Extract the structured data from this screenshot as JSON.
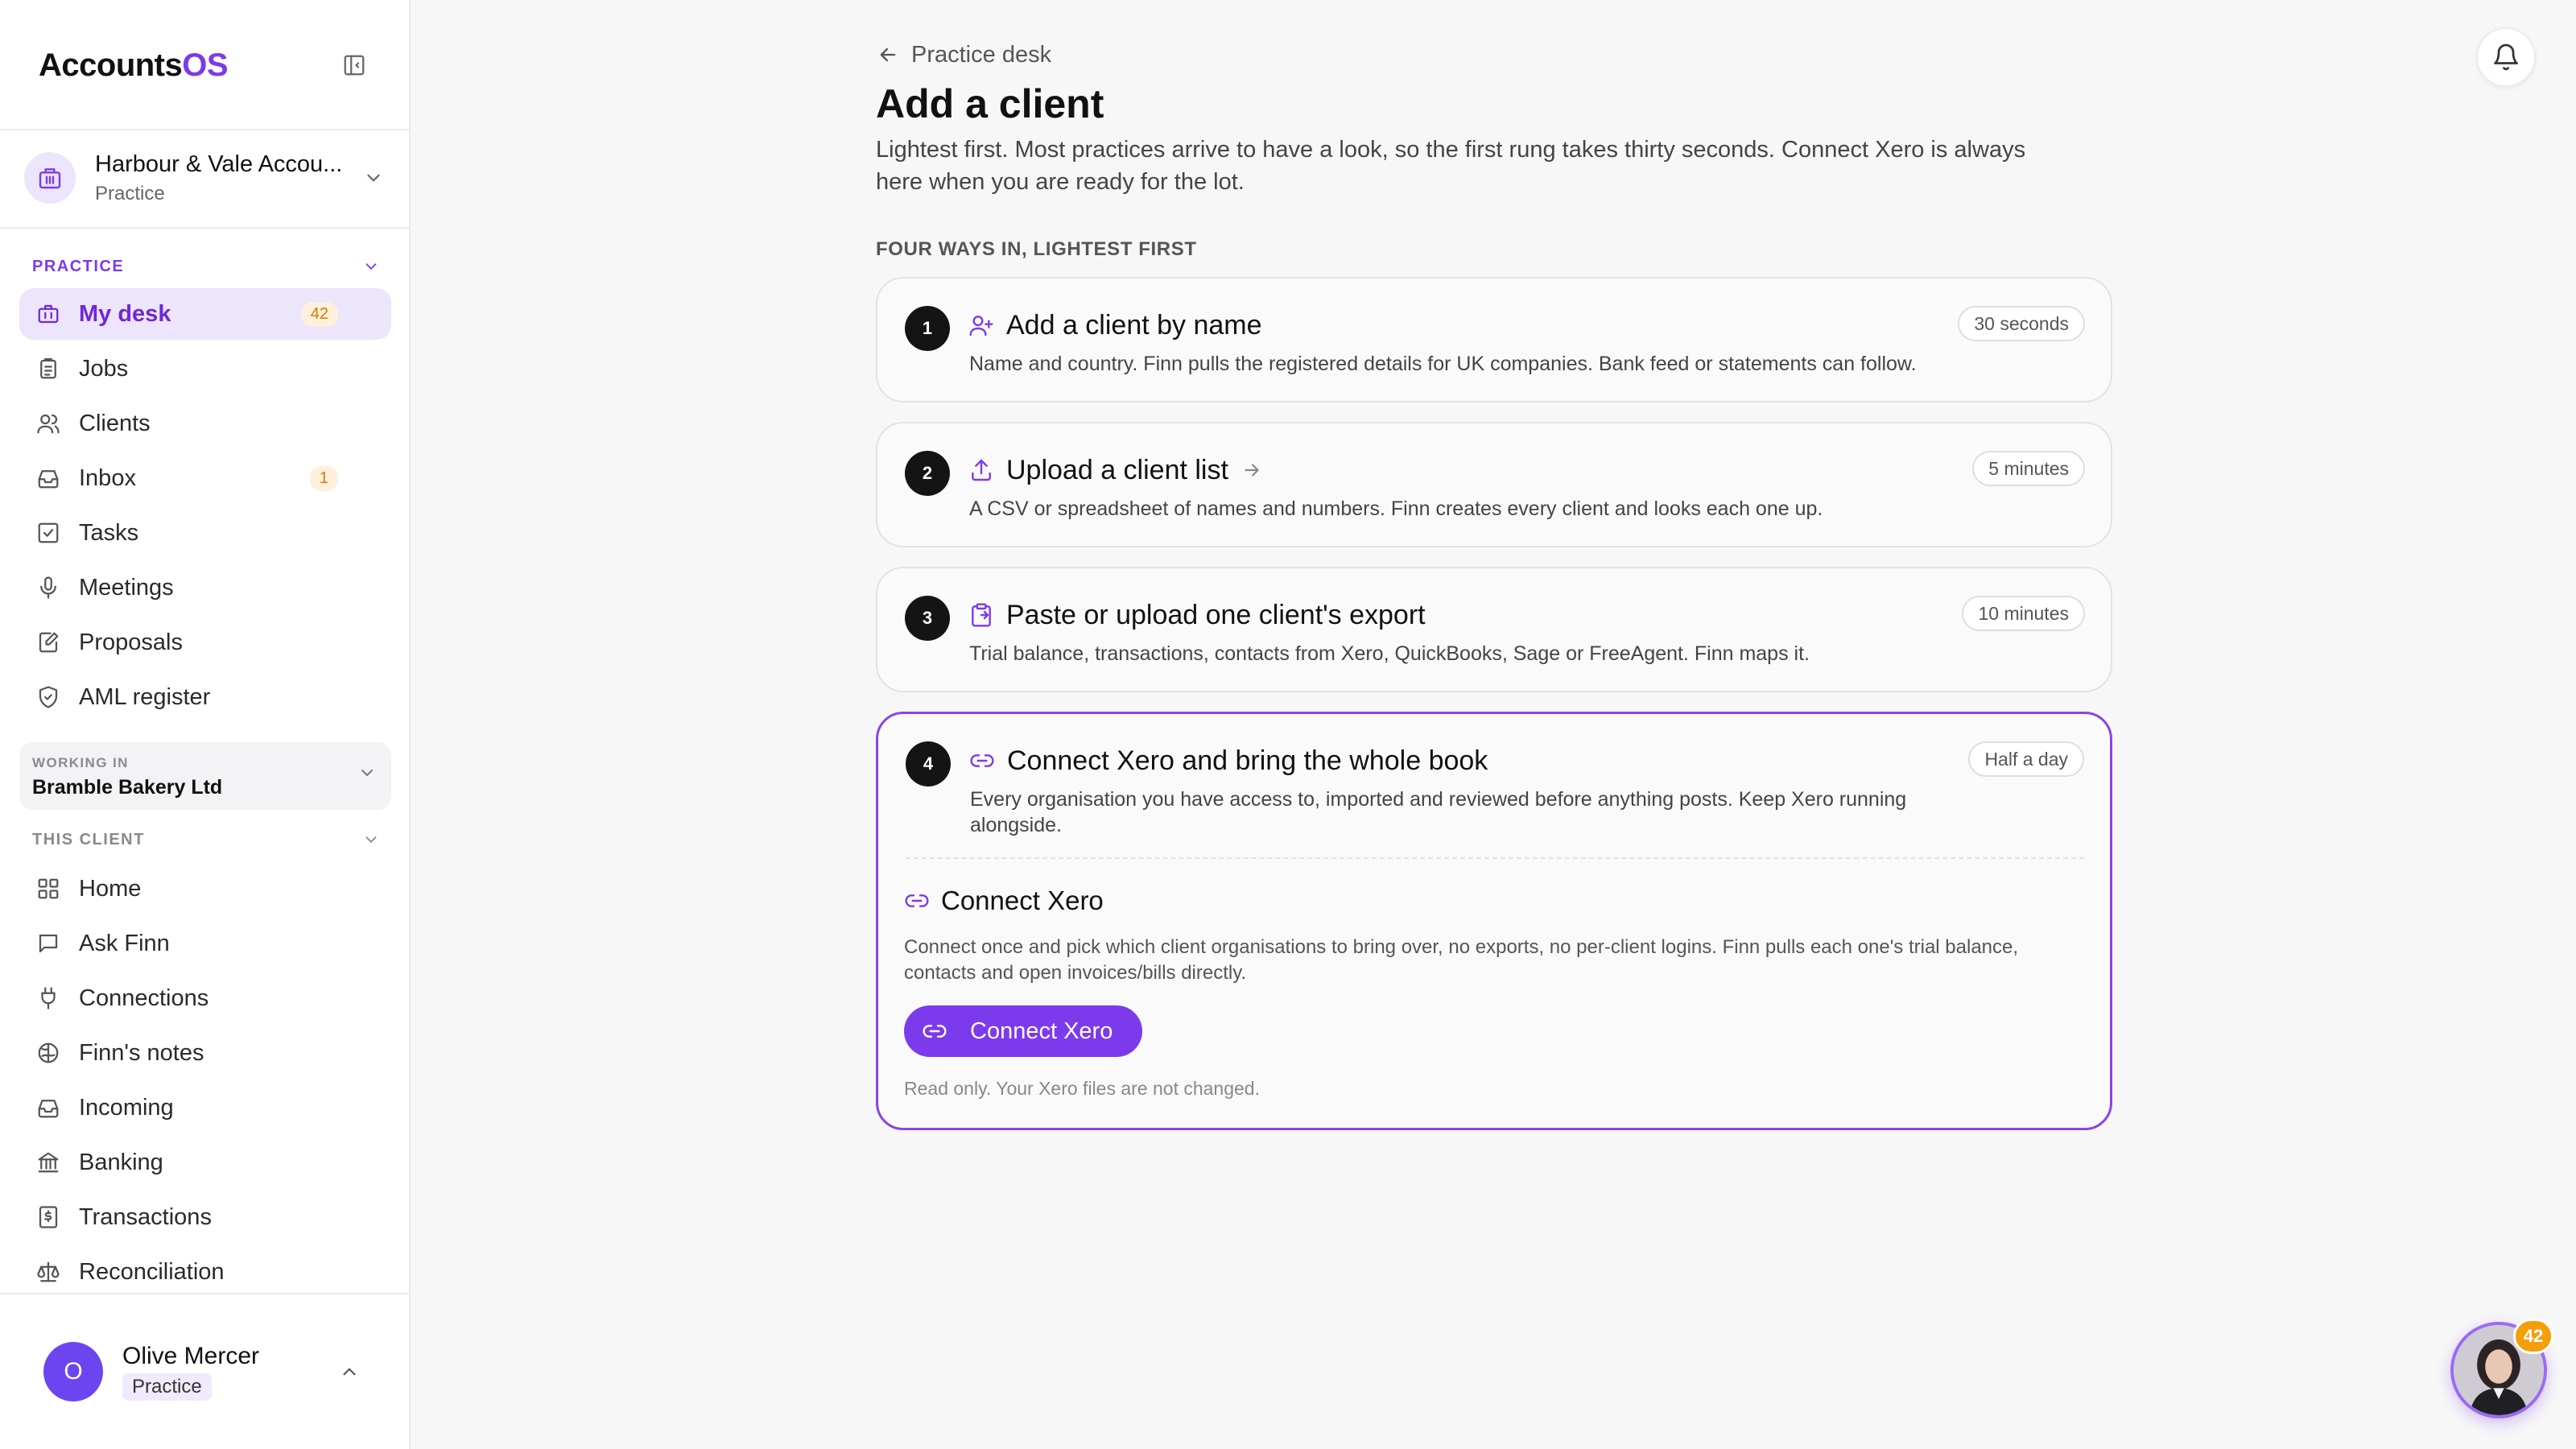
{
  "brand": {
    "name_prefix": "Accounts",
    "name_suffix": "OS"
  },
  "org": {
    "name": "Harbour & Vale Accou...",
    "subtitle": "Practice"
  },
  "practice_section": {
    "label": "PRACTICE",
    "items": [
      {
        "label": "My desk",
        "icon": "briefcase-icon",
        "badge": "42",
        "active": true
      },
      {
        "label": "Jobs",
        "icon": "clipboard-icon"
      },
      {
        "label": "Clients",
        "icon": "users-icon"
      },
      {
        "label": "Inbox",
        "icon": "inbox-icon",
        "badge": "1"
      },
      {
        "label": "Tasks",
        "icon": "check-square-icon"
      },
      {
        "label": "Meetings",
        "icon": "microphone-icon"
      },
      {
        "label": "Proposals",
        "icon": "edit-doc-icon"
      },
      {
        "label": "AML register",
        "icon": "shield-icon"
      }
    ]
  },
  "working_in": {
    "label": "WORKING IN",
    "client": "Bramble Bakery Ltd"
  },
  "client_section": {
    "label": "THIS CLIENT",
    "items": [
      {
        "label": "Home",
        "icon": "grid-icon"
      },
      {
        "label": "Ask Finn",
        "icon": "chat-icon"
      },
      {
        "label": "Connections",
        "icon": "plug-icon"
      },
      {
        "label": "Finn's notes",
        "icon": "brain-icon"
      },
      {
        "label": "Incoming",
        "icon": "inbox-icon"
      },
      {
        "label": "Banking",
        "icon": "bank-icon"
      },
      {
        "label": "Transactions",
        "icon": "receipt-icon"
      },
      {
        "label": "Reconciliation",
        "icon": "scale-icon"
      }
    ]
  },
  "user": {
    "initial": "O",
    "name": "Olive Mercer",
    "role": "Practice"
  },
  "main": {
    "back_label": "Practice desk",
    "title": "Add a client",
    "description": "Lightest first. Most practices arrive to have a look, so the first rung takes thirty seconds. Connect Xero is always here when you are ready for the lot.",
    "ways_label": "FOUR WAYS IN, LIGHTEST FIRST",
    "options": [
      {
        "number": "1",
        "title": "Add a client by name",
        "time": "30 seconds",
        "description": "Name and country. Finn pulls the registered details for UK companies. Bank feed or statements can follow."
      },
      {
        "number": "2",
        "title": "Upload a client list",
        "time": "5 minutes",
        "description": "A CSV or spreadsheet of names and numbers. Finn creates every client and looks each one up."
      },
      {
        "number": "3",
        "title": "Paste or upload one client's export",
        "time": "10 minutes",
        "description": "Trial balance, transactions, contacts from Xero, QuickBooks, Sage or FreeAgent. Finn maps it."
      },
      {
        "number": "4",
        "title": "Connect Xero and bring the whole book",
        "time": "Half a day",
        "description": "Every organisation you have access to, imported and reviewed before anything posts. Keep Xero running alongside."
      }
    ],
    "connect": {
      "title": "Connect Xero",
      "description": "Connect once and pick which client organisations to bring over, no exports, no per-client logins. Finn pulls each one's trial balance, contacts and open invoices/bills directly.",
      "button": "Connect Xero",
      "note": "Read only. Your Xero files are not changed."
    }
  },
  "assistant": {
    "badge": "42"
  },
  "colors": {
    "accent": "#7c3aed",
    "badge_orange": "#f59e0b"
  }
}
